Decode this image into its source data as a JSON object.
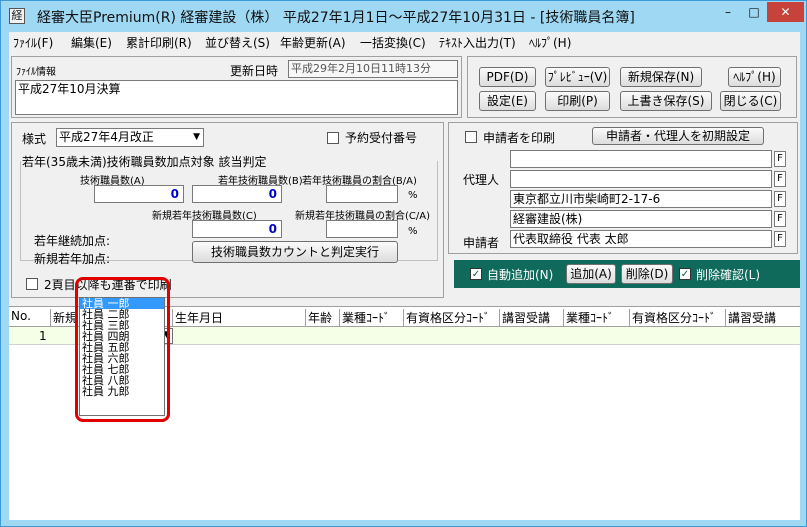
{
  "window": {
    "title": "経審大臣Premium(R)  経審建設（株）  平成27年1月1日～平成27年10月31日 - [技術職員名簿]",
    "app_icon": "経",
    "min": "–",
    "max": "□",
    "close": "✕"
  },
  "menu": [
    "ﾌｧｲﾙ(F)",
    "編集(E)",
    "累計印刷(R)",
    "並び替え(S)",
    "年齢更新(A)",
    "一括変換(C)",
    "ﾃｷｽﾄ入出力(T)",
    "ﾍﾙﾌﾟ(H)"
  ],
  "file_info": {
    "label": "ﾌｧｲﾙ情報",
    "updated_label": "更新日時",
    "updated_value": "平成29年2月10日11時13分",
    "memo": "平成27年10月決算"
  },
  "buttons": {
    "pdf": "PDF(D)",
    "preview": "ﾌﾟﾚﾋﾞｭｰ(V)",
    "save_new": "新規保存(N)",
    "help": "ﾍﾙﾌﾟ(H)",
    "settings": "設定(E)",
    "print": "印刷(P)",
    "overwrite": "上書き保存(S)",
    "close": "閉じる(C)"
  },
  "form": {
    "style_label": "様式",
    "style_value": "平成27年4月改正",
    "reservation_label": "予約受付番号",
    "group_title": "若年(35歳未満)技術職員数加点対象  該当判定",
    "tech_count_label": "技術職員数(A)",
    "tech_count_value": "0",
    "young_count_label": "若年技術職員数(B)",
    "young_count_value": "0",
    "young_ratio_label": "若年技術職員の割合(B/A)",
    "young_ratio_unit": "%",
    "new_young_label": "新規若年技術職員数(C)",
    "new_young_value": "0",
    "new_ratio_label": "新規若年技術職員の割合(C/A)",
    "new_ratio_unit": "%",
    "continuation_label": "若年継続加点:",
    "new_bonus_label": "新規若年加点:",
    "count_button": "技術職員数カウントと判定実行",
    "serial_print_label": "2頁目以降も連番で印刷"
  },
  "applicant": {
    "print_label": "申請者を印刷",
    "init_button": "申請者・代理人を初期設定",
    "agent_label": "代理人",
    "applicant_label": "申請者",
    "agent_fields": [
      "",
      "",
      "東京都立川市柴崎町2-17-6",
      "経審建設(株)"
    ],
    "applicant_field": "代表取締役    代表  太郎",
    "f_label": "F"
  },
  "actions": {
    "auto_add": "自動追加(N)",
    "add": "追加(A)",
    "delete": "削除(D)",
    "delete_confirm": "削除確認(L)"
  },
  "grid": {
    "columns": [
      "No.",
      "新規",
      "氏    名",
      "生年月日",
      "年齢",
      "業種ｺｰﾄﾞ",
      "有資格区分ｺｰﾄﾞ",
      "講習受講",
      "業種ｺｰﾄﾞ",
      "有資格区分ｺｰﾄﾞ",
      "講習受講"
    ],
    "row_no": "1"
  },
  "dropdown": {
    "arrow": "▼",
    "options": [
      "社員  一郎",
      "社員  二郎",
      "社員  三郎",
      "社員  四朗",
      "社員  五郎",
      "社員  六郎",
      "社員  七郎",
      "社員  八郎",
      "社員  九郎"
    ],
    "selected_index": 0
  },
  "colors": {
    "title_bg": "#9fd8f3",
    "green_panel": "#0f6a5b",
    "selection": "#3399ff",
    "highlight": "#e00000"
  }
}
